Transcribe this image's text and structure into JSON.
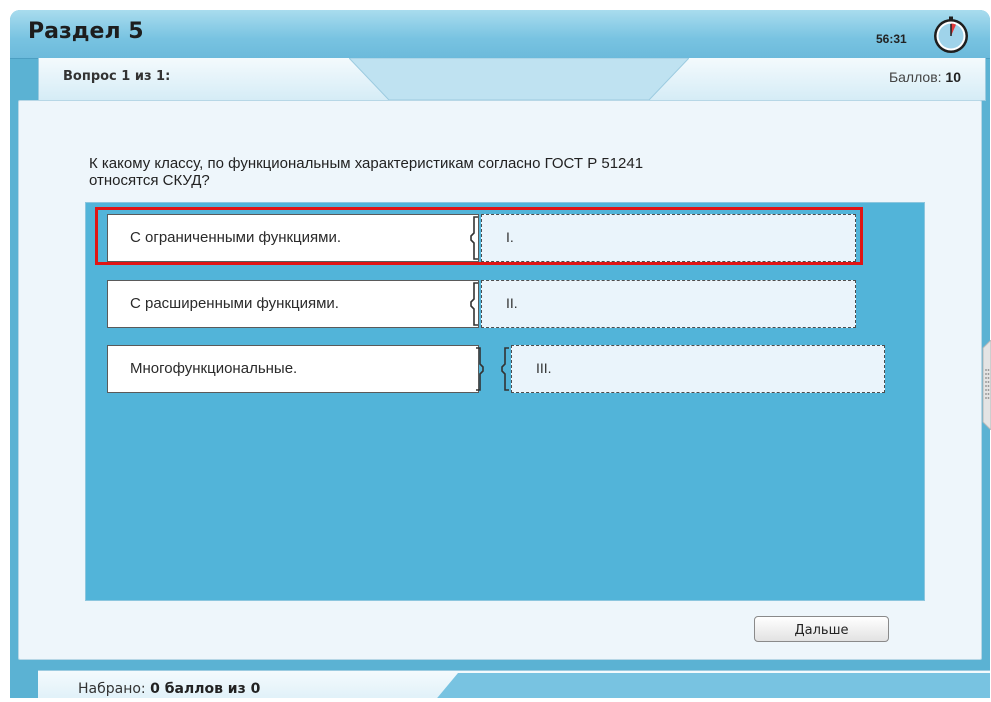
{
  "header": {
    "section_title": "Раздел 5",
    "timer": "56:31"
  },
  "info_bar": {
    "question_counter": "Вопрос 1 из 1:",
    "score_label": "Баллов:",
    "score_value": "10"
  },
  "question": {
    "text_line1": "К какому классу, по функциональным характеристикам согласно ГОСТ Р 51241",
    "text_line2": "относятся СКУД?"
  },
  "matching": {
    "left_items": [
      "С ограниченными функциями.",
      "С расширенными функциями.",
      "Многофункциональные."
    ],
    "right_items": [
      "I.",
      "II.",
      "III."
    ]
  },
  "buttons": {
    "next_label": "Дальше"
  },
  "footer": {
    "total_label": "Набрано:",
    "total_value": "0 баллов из 0"
  },
  "colors": {
    "frame": "#5bb2d3",
    "match_area": "#52b4d9",
    "highlight": "#e01515",
    "panel": "#eef6fb"
  },
  "icons": {
    "timer": "stopwatch-icon",
    "side_handle": "grip-dots-icon"
  }
}
